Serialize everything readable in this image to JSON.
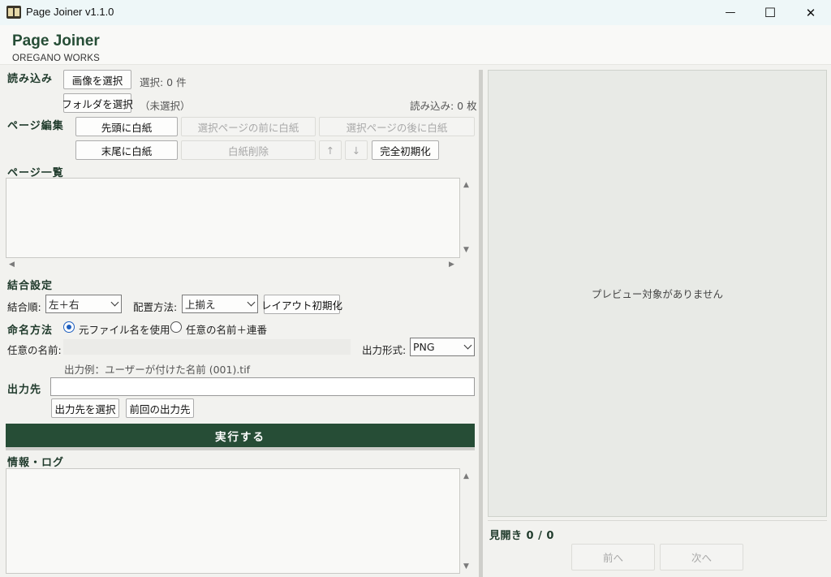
{
  "window": {
    "title": "Page Joiner v1.1.0",
    "minimize_glyph": "—",
    "maximize_glyph": "☐",
    "close_glyph": "✕"
  },
  "header": {
    "app_name": "Page Joiner",
    "company": "OREGANO WORKS"
  },
  "load": {
    "label": "読み込み",
    "select_images": "画像を選択",
    "selected_count": "選択: 0 件",
    "select_folder": "フォルダを選択",
    "folder_status": "（未選択）",
    "loaded_count": "読み込み: 0 枚"
  },
  "page_edit": {
    "label": "ページ編集",
    "blank_first": "先頭に白紙",
    "blank_before": "選択ページの前に白紙",
    "blank_after": "選択ページの後に白紙",
    "blank_last": "末尾に白紙",
    "delete_blank": "白紙削除",
    "move_up": "↑",
    "move_down": "↓",
    "reset_all": "完全初期化"
  },
  "page_list": {
    "label": "ページ一覧"
  },
  "combine": {
    "label": "結合設定",
    "order_label": "結合順:",
    "order_value": "左＋右",
    "align_label": "配置方法:",
    "align_value": "上揃え",
    "reset_layout": "レイアウト初期化"
  },
  "naming": {
    "label": "命名方法",
    "option_original": "元ファイル名を使用",
    "option_custom": "任意の名前＋連番",
    "custom_name_label": "任意の名前:",
    "custom_name_value": "",
    "format_label": "出力形式:",
    "format_value": "PNG",
    "example": "出力例：ユーザーが付けた名前 (001).tif"
  },
  "output": {
    "label": "出力先",
    "path_value": "",
    "choose_dest": "出力先を選択",
    "previous_dest": "前回の出力先"
  },
  "run_button": "実行する",
  "log": {
    "label": "情報・ログ"
  },
  "preview": {
    "empty_text": "プレビュー対象がありません",
    "spread_label": "見開き 0 / 0",
    "prev": "前へ",
    "next": "次へ"
  },
  "colors": {
    "accent": "#264d36",
    "radio_selected": "#1e5fbf"
  }
}
